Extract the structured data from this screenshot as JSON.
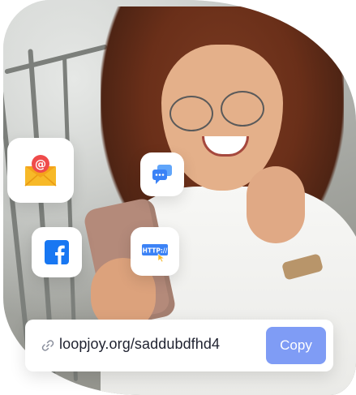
{
  "hero": {
    "photo_subject": "smiling woman holding phone"
  },
  "tiles": [
    {
      "name": "email",
      "icon": "email-at-icon"
    },
    {
      "name": "chat",
      "icon": "chat-bubbles-icon"
    },
    {
      "name": "facebook",
      "icon": "facebook-icon"
    },
    {
      "name": "http",
      "icon": "http-link-icon",
      "label": "HTTP://"
    }
  ],
  "share": {
    "url": "loopjoy.org/saddubdfhd4",
    "copy_label": "Copy",
    "link_icon": "link-icon"
  },
  "colors": {
    "accent": "#7f9cf5",
    "email_envelope": "#f7b928",
    "email_at": "#ef4b4b",
    "facebook_blue": "#1877f2",
    "chat_blue": "#3b82f6",
    "text_dark": "#1f2230"
  }
}
